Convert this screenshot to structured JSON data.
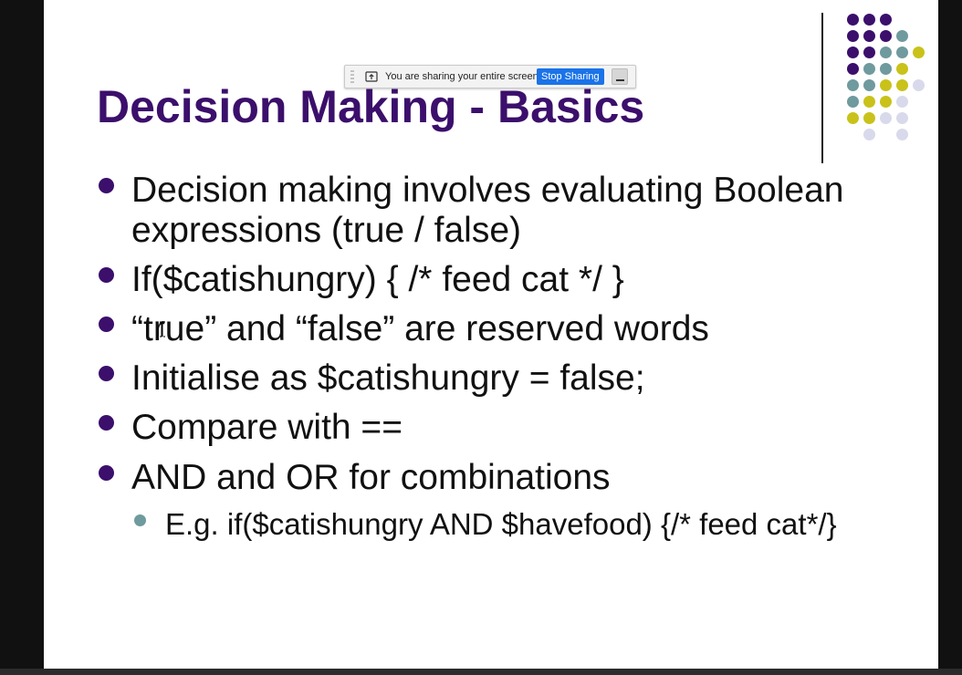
{
  "slide": {
    "title": "Decision Making - Basics",
    "bullets": [
      {
        "text": "Decision making involves evaluating Boolean expressions (true / false)",
        "level": 1
      },
      {
        "text": "If($catishungry) { /* feed cat */ }",
        "level": 1
      },
      {
        "text": "“true” and “false” are reserved words",
        "level": 1
      },
      {
        "text": "Initialise as $catishungry = false;",
        "level": 1
      },
      {
        "text": "Compare with ==",
        "level": 1
      },
      {
        "text": "AND and OR for combinations",
        "level": 1
      },
      {
        "text": "E.g. if($catishungry AND $havefood) {/* feed cat*/}",
        "level": 2
      }
    ],
    "colors": {
      "title": "#3b0f6b",
      "bullet_level1": "#3b0f6b",
      "bullet_level2": "#6f9a9e",
      "dot_purple": "#3b0f6b",
      "dot_teal": "#6f9a9e",
      "dot_yellow": "#c9c21a",
      "dot_lavender": "#d9d9ec"
    }
  },
  "share_bar": {
    "message": "You are sharing your entire screen.",
    "stop_label": "Stop Sharing",
    "icons": {
      "grip": "drag-grip-icon",
      "share": "screen-share-icon",
      "hide": "minimize-icon"
    }
  }
}
